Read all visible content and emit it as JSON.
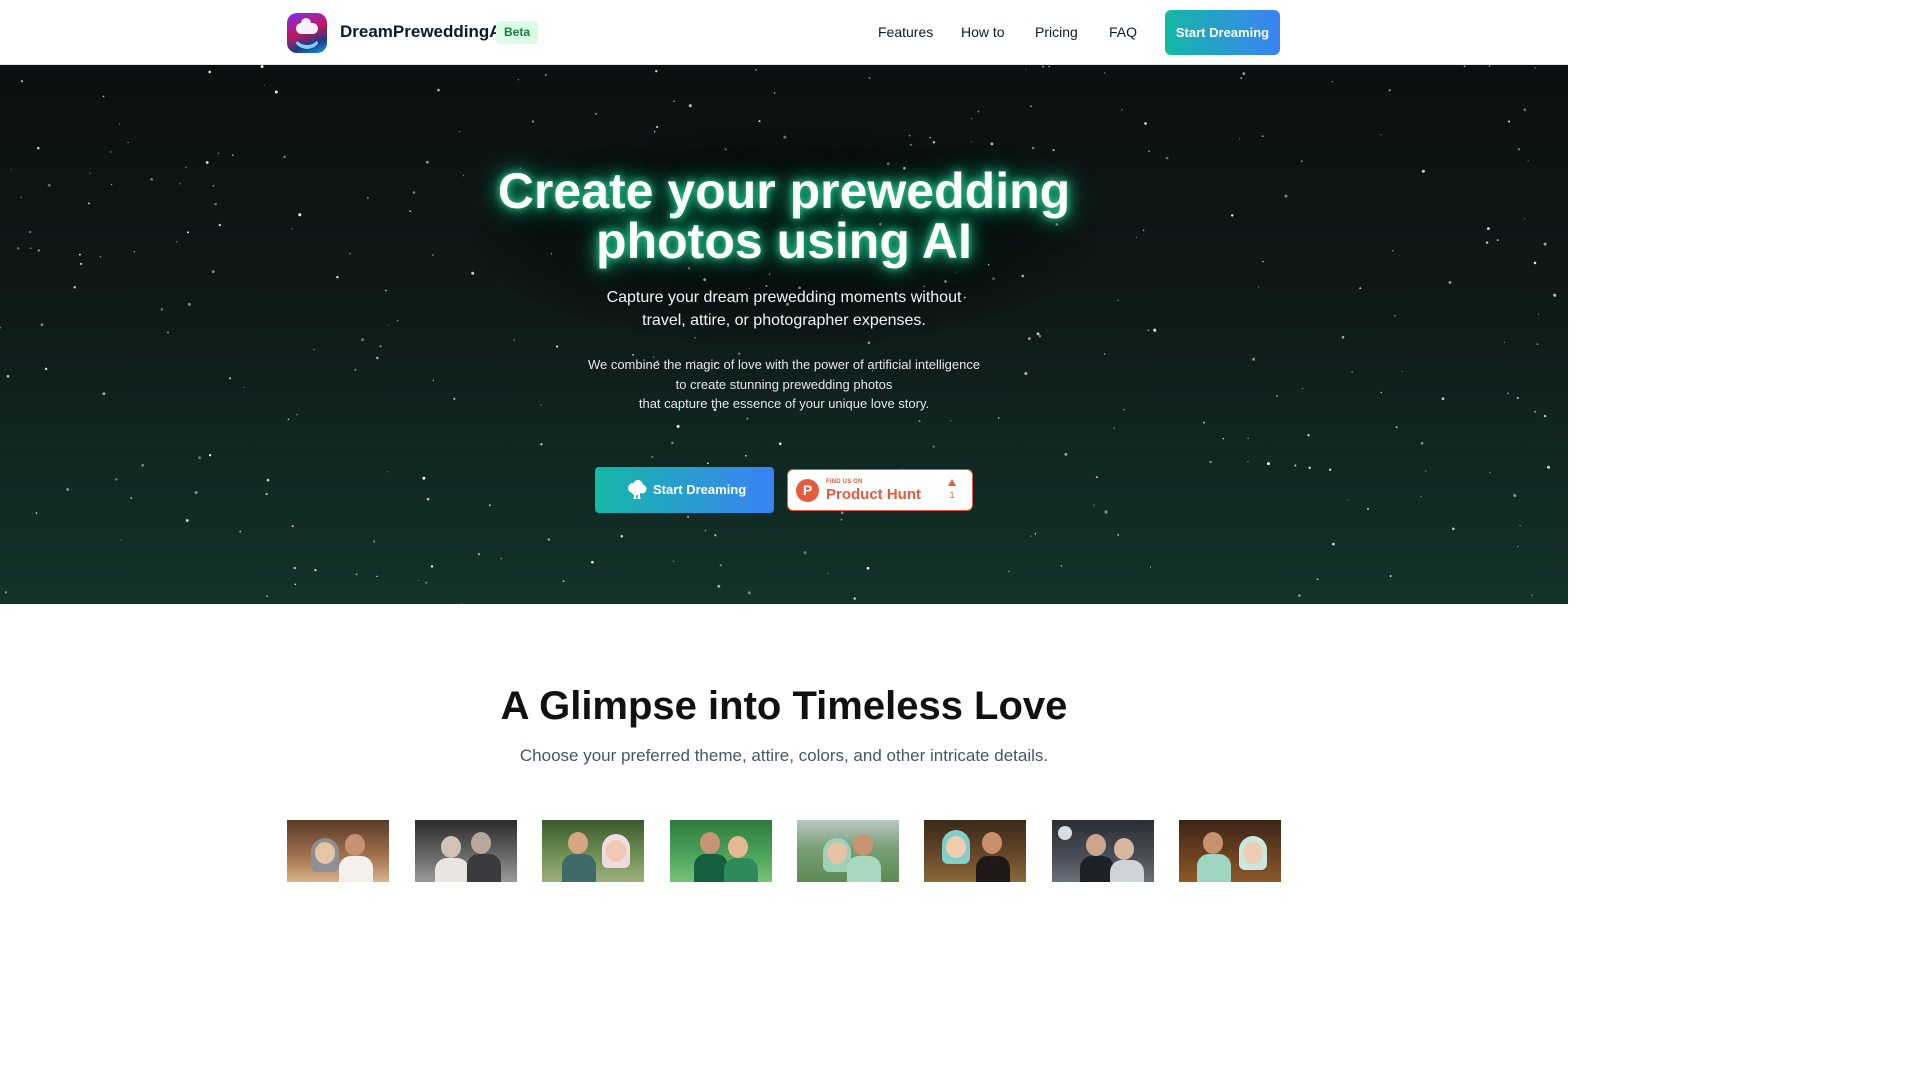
{
  "nav": {
    "brand": "DreamPreweddingAI",
    "badge": "Beta",
    "links": [
      "Features",
      "How to",
      "Pricing",
      "FAQ"
    ],
    "cta": "Start Dreaming",
    "logo_icon": "cloud-moon-logo-icon"
  },
  "hero": {
    "headline_line1": "Create your prewedding",
    "headline_line2": "photos using AI",
    "subtitle_line1": "Capture your dream prewedding moments without",
    "subtitle_line2": "travel, attire, or photographer expenses.",
    "description_line1": "We combine the magic of love with the power of artificial intelligence",
    "description_line2": "to create stunning prewedding photos",
    "description_line3": "that capture the essence of your unique love story.",
    "cta": "Start Dreaming",
    "cta_icon": "brain-cloud-icon",
    "product_hunt": {
      "small_text": "FIND US ON",
      "big_text": "Product Hunt",
      "letter": "P",
      "upvotes": "1"
    }
  },
  "gallery": {
    "title": "A Glimpse into Timeless Love",
    "subtitle": "Choose your preferred theme, attire, colors, and other intricate details."
  },
  "colors": {
    "accent_start": "#14b8a6",
    "accent_end": "#3b82f6",
    "glow": "#10b981",
    "product_hunt": "#e85a3d",
    "beta_bg": "#dcfce7",
    "beta_text": "#15803d"
  }
}
